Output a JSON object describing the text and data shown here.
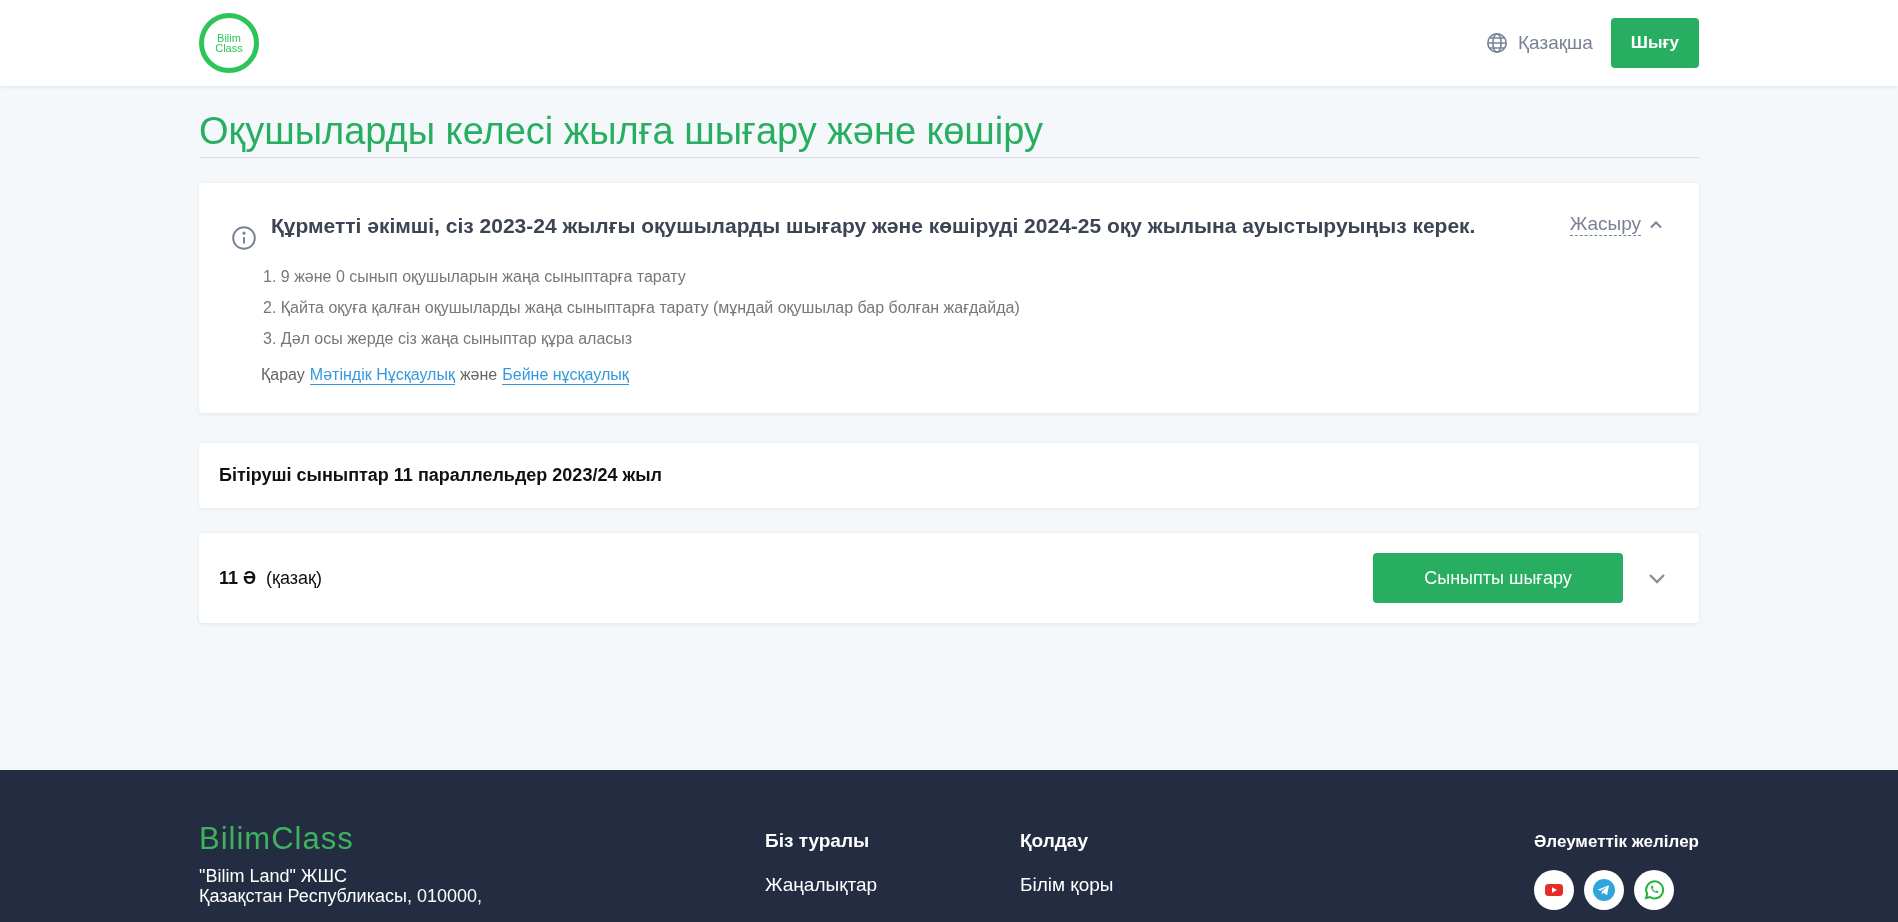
{
  "header": {
    "logo_text": [
      "Bilim",
      "Class"
    ],
    "language": "Қазақша",
    "logout_button": "Шығу"
  },
  "page_title": "Оқушыларды келесі жылға шығару және көшіру",
  "notice": {
    "heading": "Құрметті әкімші, сіз 2023-24 жылғы оқушыларды шығару және көшіруді 2024-25 оқу жылына ауыстыруыңыз керек.",
    "toggle": "Жасыру",
    "expanded": true,
    "steps": [
      "1. 9 және 0 сынып оқушыларын жаңа сыныптарға тарату",
      "2. Қайта оқуға қалған оқушыларды жаңа сыныптарға тарату (мұндай оқушылар бар болған жағдайда)",
      "3. Дәл осы жерде сіз жаңа сыныптар құра аласыз"
    ],
    "links_prefix": "Қарау",
    "link_1": "Мәтіндік Нұсқаулық",
    "links_joiner": "және",
    "link_2": "Бейне нұсқаулық"
  },
  "section_header": "Бітіруші сыныптар 11 параллельдер 2023/24 жыл",
  "classes": [
    {
      "name": "11 Ә",
      "language": "(қазақ)",
      "action_button": "Сыныпты шығару",
      "expanded": false
    }
  ],
  "footer": {
    "brand": "BilimClass",
    "address": [
      "\"Bilim Land\" ЖШС",
      "Қазақстан Республикасы, 010000,"
    ],
    "columns": [
      {
        "heading": "Біз туралы",
        "items": [
          "Жаңалықтар"
        ]
      },
      {
        "heading": "Қолдау",
        "items": [
          "Білім қоры"
        ]
      }
    ],
    "social_heading": "Әлеуметтік желілер",
    "social_links": [
      {
        "kind": "youtube"
      },
      {
        "kind": "telegram"
      },
      {
        "kind": "whatsapp"
      }
    ]
  }
}
